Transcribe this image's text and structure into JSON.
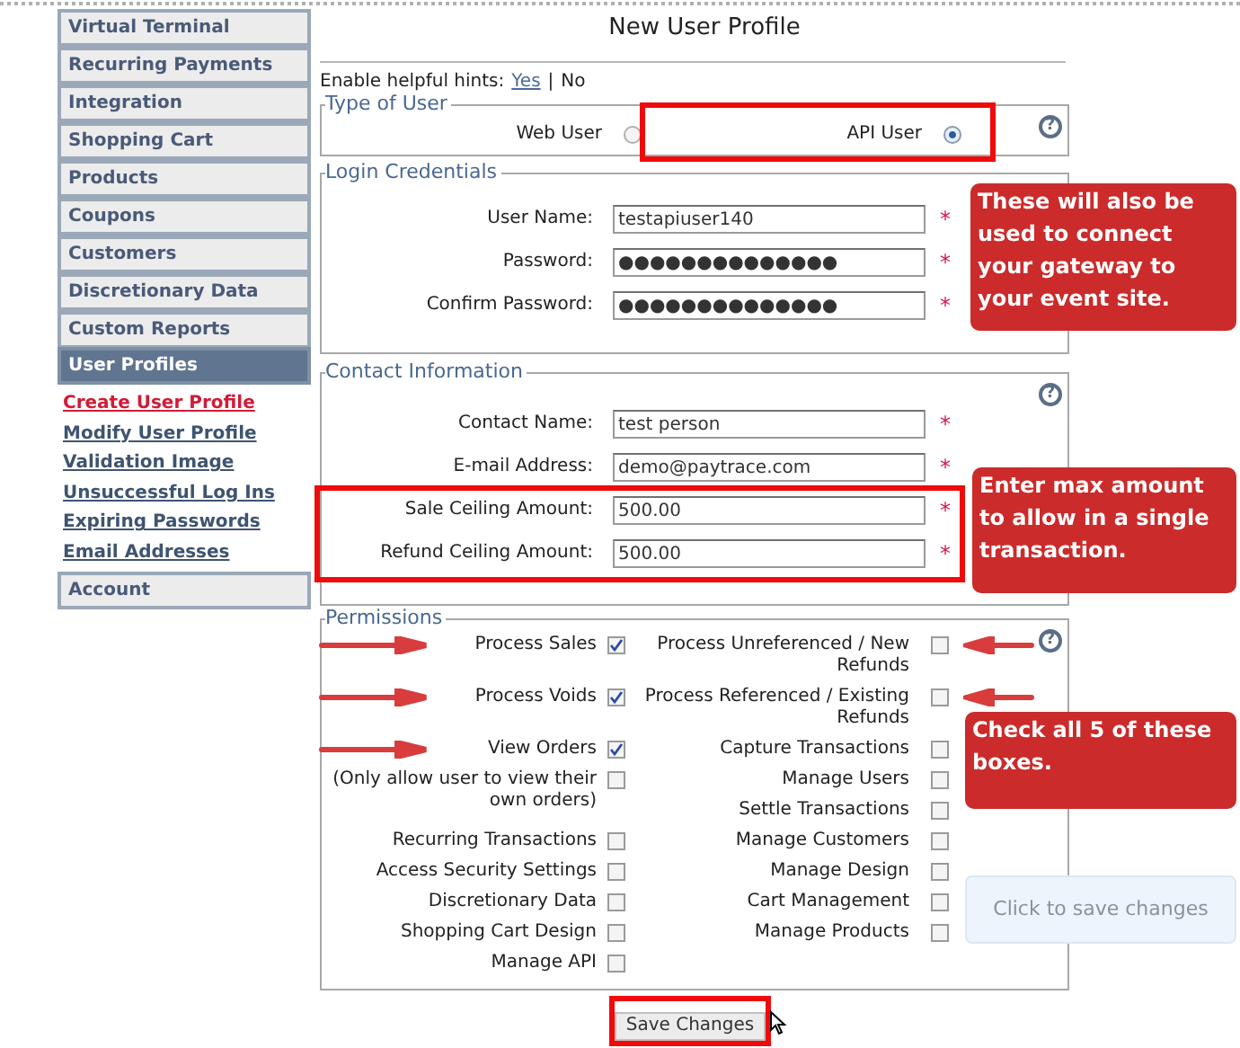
{
  "title": "New User Profile",
  "sidebar": {
    "items": [
      {
        "label": "Virtual Terminal",
        "selected": false
      },
      {
        "label": "Recurring Payments",
        "selected": false
      },
      {
        "label": "Integration",
        "selected": false
      },
      {
        "label": "Shopping Cart",
        "selected": false
      },
      {
        "label": "Products",
        "selected": false
      },
      {
        "label": "Coupons",
        "selected": false
      },
      {
        "label": "Customers",
        "selected": false
      },
      {
        "label": "Discretionary Data",
        "selected": false
      },
      {
        "label": "Custom Reports",
        "selected": false
      },
      {
        "label": "User Profiles",
        "selected": true,
        "children": [
          {
            "label": "Create User Profile",
            "selected": true
          },
          {
            "label": "Modify User Profile",
            "selected": false
          },
          {
            "label": "Validation Image",
            "selected": false
          },
          {
            "label": "Unsuccessful Log Ins",
            "selected": false
          },
          {
            "label": "Expiring Passwords",
            "selected": false
          },
          {
            "label": "Email Addresses",
            "selected": false
          }
        ]
      },
      {
        "label": "Account",
        "selected": false
      }
    ]
  },
  "hints": {
    "label": "Enable helpful hints:",
    "separator": "|",
    "options": [
      {
        "label": "Yes",
        "selected": false
      },
      {
        "label": "No",
        "selected": true
      }
    ]
  },
  "type_of_user": {
    "legend": "Type of User",
    "help": "?",
    "options": [
      {
        "label": "Web User",
        "selected": false,
        "highlighted": false
      },
      {
        "label": "API User",
        "selected": true,
        "highlighted": true
      }
    ]
  },
  "login_credentials": {
    "legend": "Login Credentials",
    "fields": [
      {
        "label": "User Name:",
        "value": "testapiuser140",
        "marker": "*",
        "highlighted": false
      },
      {
        "label": "Password:",
        "value": "●●●●●●●●●●●●●●",
        "marker": "*",
        "highlighted": false
      },
      {
        "label": "Confirm Password:",
        "value": "●●●●●●●●●●●●●●",
        "marker": "*",
        "highlighted": false
      }
    ]
  },
  "contact_information": {
    "legend": "Contact Information",
    "help": "?",
    "fields": [
      {
        "label": "Contact Name:",
        "value": "test person",
        "marker": "*",
        "highlighted": false
      },
      {
        "label": "E-mail Address:",
        "value": "demo@paytrace.com",
        "marker": "*",
        "highlighted": false
      },
      {
        "label": "Sale Ceiling Amount:",
        "value": "500.00",
        "marker": "*",
        "highlighted": true
      },
      {
        "label": "Refund Ceiling Amount:",
        "value": "500.00",
        "marker": "*",
        "highlighted": true
      }
    ]
  },
  "permissions": {
    "legend": "Permissions",
    "help": "?",
    "rows": [
      {
        "left": {
          "label": "Process Sales",
          "checked": true,
          "arrow": true
        },
        "right": {
          "label": "Process Unreferenced / New Refunds",
          "checked": false,
          "arrow": true
        }
      },
      {
        "left": {
          "label": "Process Voids",
          "checked": true,
          "arrow": true
        },
        "right": {
          "label": "Process Referenced / Existing Refunds",
          "checked": false,
          "arrow": true
        }
      },
      {
        "left": {
          "label": "View Orders",
          "checked": true,
          "arrow": true
        },
        "right": {
          "label": "Capture Transactions",
          "checked": false,
          "arrow": false
        }
      },
      {
        "left": {
          "label": "(Only allow user to view their own orders)",
          "checked": false,
          "arrow": false
        },
        "right": {
          "label": "Manage Users",
          "checked": false,
          "arrow": false
        }
      },
      {
        "right": {
          "label": "Settle Transactions",
          "checked": false,
          "arrow": false
        }
      },
      {
        "left": {
          "label": "Recurring Transactions",
          "checked": false,
          "arrow": false
        },
        "right": {
          "label": "Manage Customers",
          "checked": false,
          "arrow": false
        }
      },
      {
        "left": {
          "label": "Access Security Settings",
          "checked": false,
          "arrow": false
        },
        "right": {
          "label": "Manage Design",
          "checked": false,
          "arrow": false
        }
      },
      {
        "left": {
          "label": "Discretionary Data",
          "checked": false,
          "arrow": false
        },
        "right": {
          "label": "Cart Management",
          "checked": false,
          "arrow": false
        }
      },
      {
        "left": {
          "label": "Shopping Cart Design",
          "checked": false,
          "arrow": false
        },
        "right": {
          "label": "Manage Products",
          "checked": false,
          "arrow": false
        }
      },
      {
        "left": {
          "label": "Manage API",
          "checked": false,
          "arrow": false
        }
      }
    ]
  },
  "save_button": {
    "label": "Save Changes",
    "highlighted": true
  },
  "tooltip": {
    "text": "Click to save changes"
  },
  "callouts": [
    {
      "text": "These will also be used to connect your gateway to your event site."
    },
    {
      "text": "Enter max amount to allow in a single transaction."
    },
    {
      "text": "Check all 5 of these boxes."
    }
  ]
}
